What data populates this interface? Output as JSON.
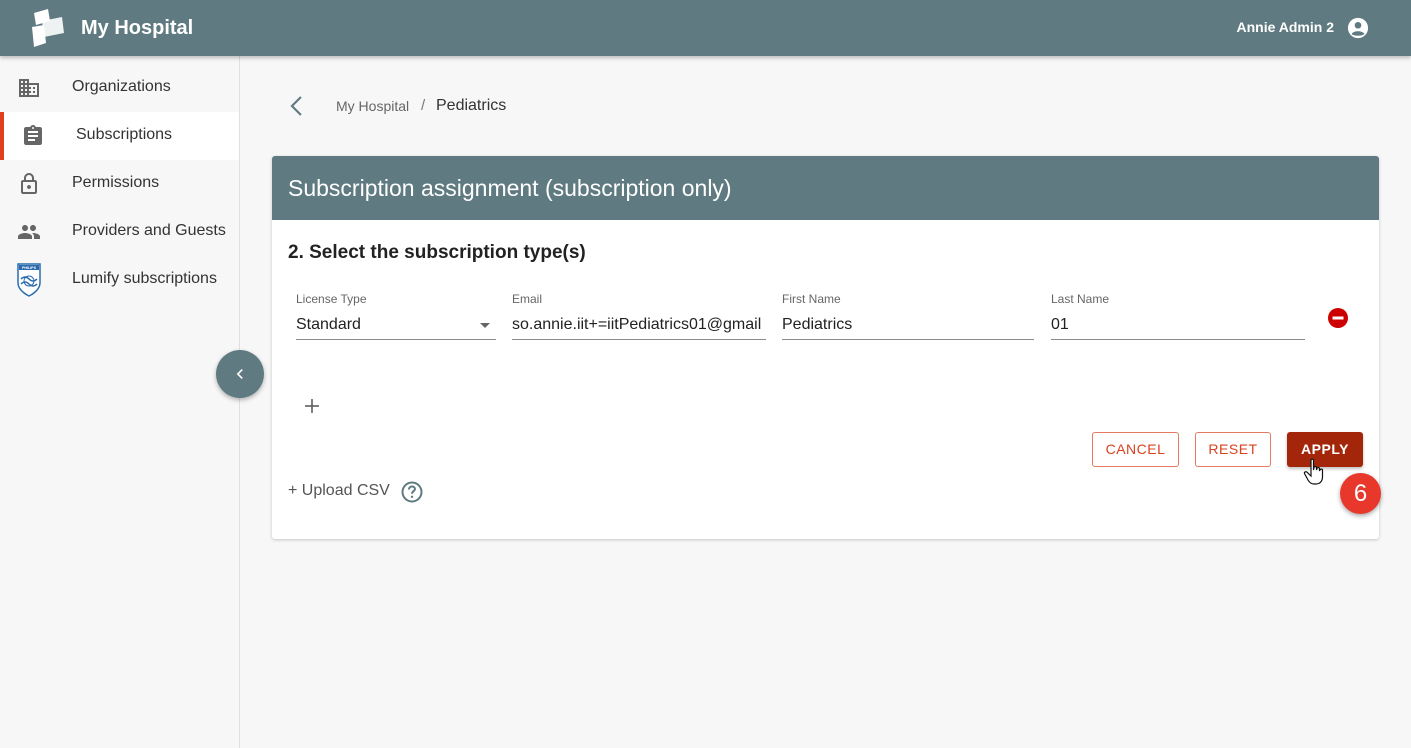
{
  "app": {
    "title": "My Hospital",
    "user_name": "Annie Admin 2"
  },
  "sidebar": {
    "items": [
      {
        "label": "Organizations",
        "icon": "building-icon"
      },
      {
        "label": "Subscriptions",
        "icon": "clipboard-icon",
        "active": true
      },
      {
        "label": "Permissions",
        "icon": "lock-icon"
      },
      {
        "label": "Providers and Guests",
        "icon": "people-icon"
      },
      {
        "label": "Lumify subscriptions",
        "icon": "philips-shield-icon"
      }
    ],
    "logo_text": "PHILIPS"
  },
  "breadcrumb": {
    "root": "My Hospital",
    "separator": "/",
    "current": "Pediatrics"
  },
  "card": {
    "title": "Subscription assignment (subscription only)",
    "step_title": "2. Select the subscription type(s)",
    "fields": {
      "license_type": {
        "label": "License Type",
        "value": "Standard"
      },
      "email": {
        "label": "Email",
        "value": "so.annie.iit+=iitPediatrics01@gmail"
      },
      "first_name": {
        "label": "First Name",
        "value": "Pediatrics"
      },
      "last_name": {
        "label": "Last Name",
        "value": "01"
      }
    },
    "buttons": {
      "cancel": "CANCEL",
      "reset": "RESET",
      "apply": "APPLY"
    },
    "upload_label": "+ Upload CSV"
  },
  "step_badge": "6",
  "colors": {
    "header": "#5f7a80",
    "accent": "#e0401c",
    "apply": "#a3260b",
    "badge": "#e8382b",
    "remove": "#cc0000"
  }
}
